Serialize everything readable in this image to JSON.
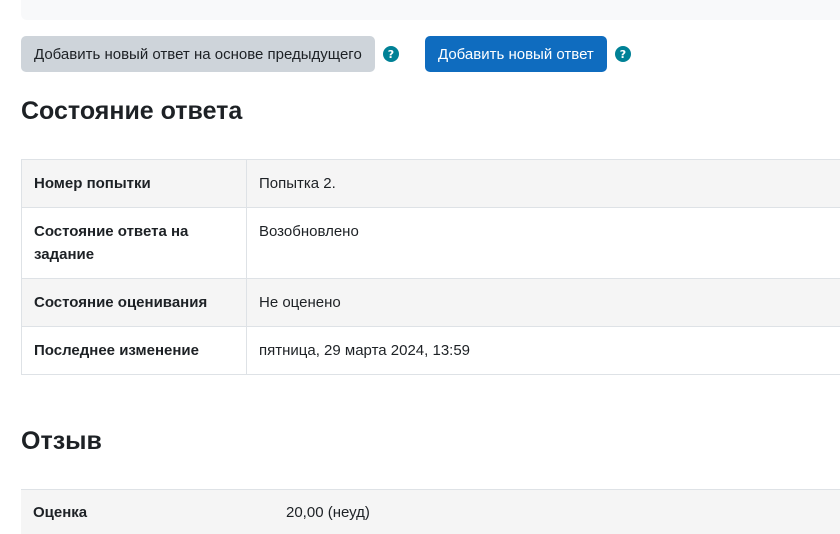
{
  "buttons": {
    "add_from_previous": "Добавить новый ответ на основе предыдущего",
    "add_new": "Добавить новый ответ",
    "help_glyph": "?"
  },
  "submission_status": {
    "heading": "Состояние ответа",
    "rows": [
      {
        "label": "Номер попытки",
        "value": "Попытка 2."
      },
      {
        "label": "Состояние ответа на задание",
        "value": "Возобновлено"
      },
      {
        "label": "Состояние оценивания",
        "value": "Не оценено"
      },
      {
        "label": "Последнее изменение",
        "value": "пятница, 29 марта 2024, 13:59"
      }
    ]
  },
  "feedback": {
    "heading": "Отзыв",
    "grade_label": "Оценка",
    "grade_value": "20,00 (неуд)"
  },
  "colors": {
    "primary": "#0f6cbf",
    "secondary": "#ced4da",
    "help_icon": "#008196"
  },
  "icons": {
    "help": "question-circle-icon"
  }
}
